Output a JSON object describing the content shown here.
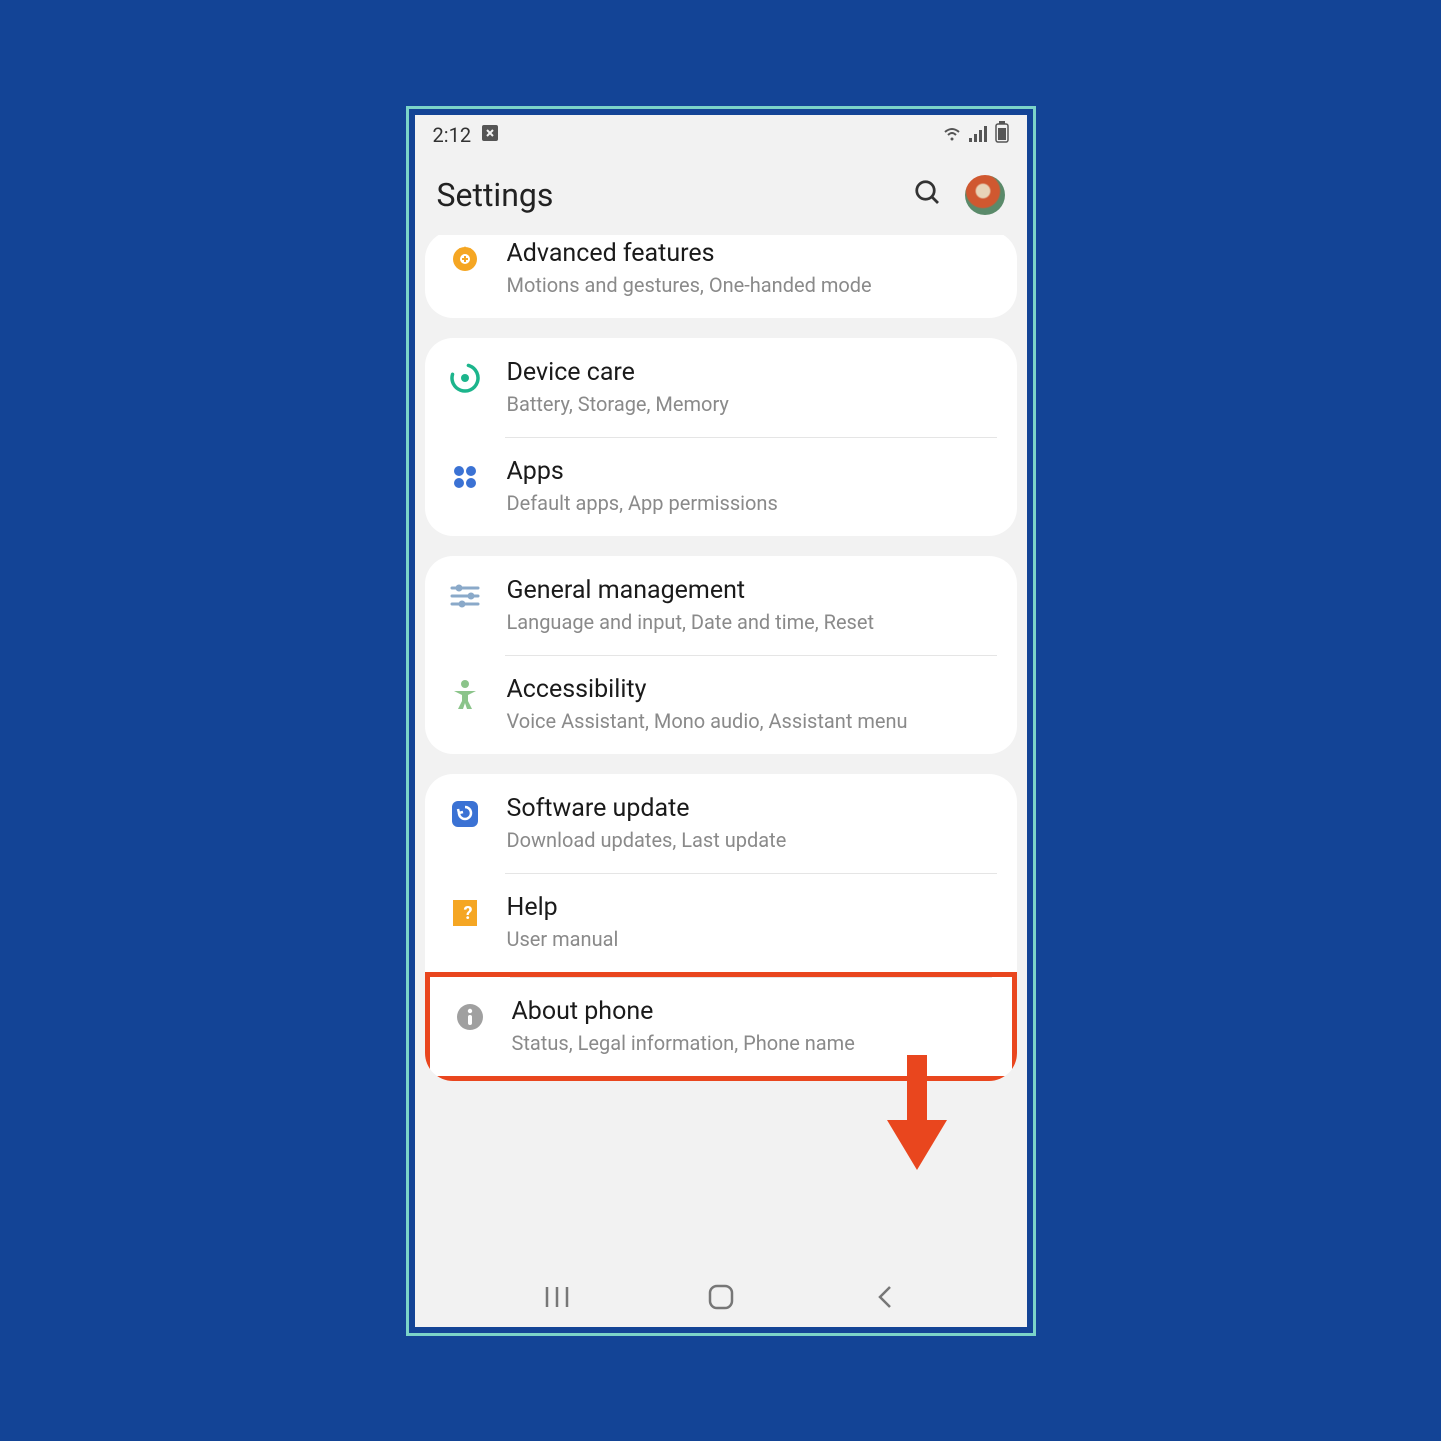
{
  "status": {
    "time": "2:12"
  },
  "header": {
    "title": "Settings"
  },
  "groups": [
    {
      "items": [
        {
          "title": "Advanced features",
          "sub": "Motions and gestures, One-handed mode",
          "icon": "gear-plus",
          "color": "#f5a623"
        }
      ]
    },
    {
      "items": [
        {
          "title": "Device care",
          "sub": "Battery, Storage, Memory",
          "icon": "device-care",
          "color": "#1cb58c"
        },
        {
          "title": "Apps",
          "sub": "Default apps, App permissions",
          "icon": "apps",
          "color": "#3b72d4"
        }
      ]
    },
    {
      "items": [
        {
          "title": "General management",
          "sub": "Language and input, Date and time, Reset",
          "icon": "sliders",
          "color": "#8aa9c9"
        },
        {
          "title": "Accessibility",
          "sub": "Voice Assistant, Mono audio, Assistant menu",
          "icon": "person",
          "color": "#8bc48a"
        }
      ]
    },
    {
      "items": [
        {
          "title": "Software update",
          "sub": "Download updates, Last update",
          "icon": "update",
          "color": "#3b72d4"
        },
        {
          "title": "Help",
          "sub": "User manual",
          "icon": "help",
          "color": "#f5a623"
        },
        {
          "title": "About phone",
          "sub": "Status, Legal information, Phone name",
          "icon": "info",
          "color": "#a0a0a0",
          "highlight": true
        }
      ]
    }
  ]
}
